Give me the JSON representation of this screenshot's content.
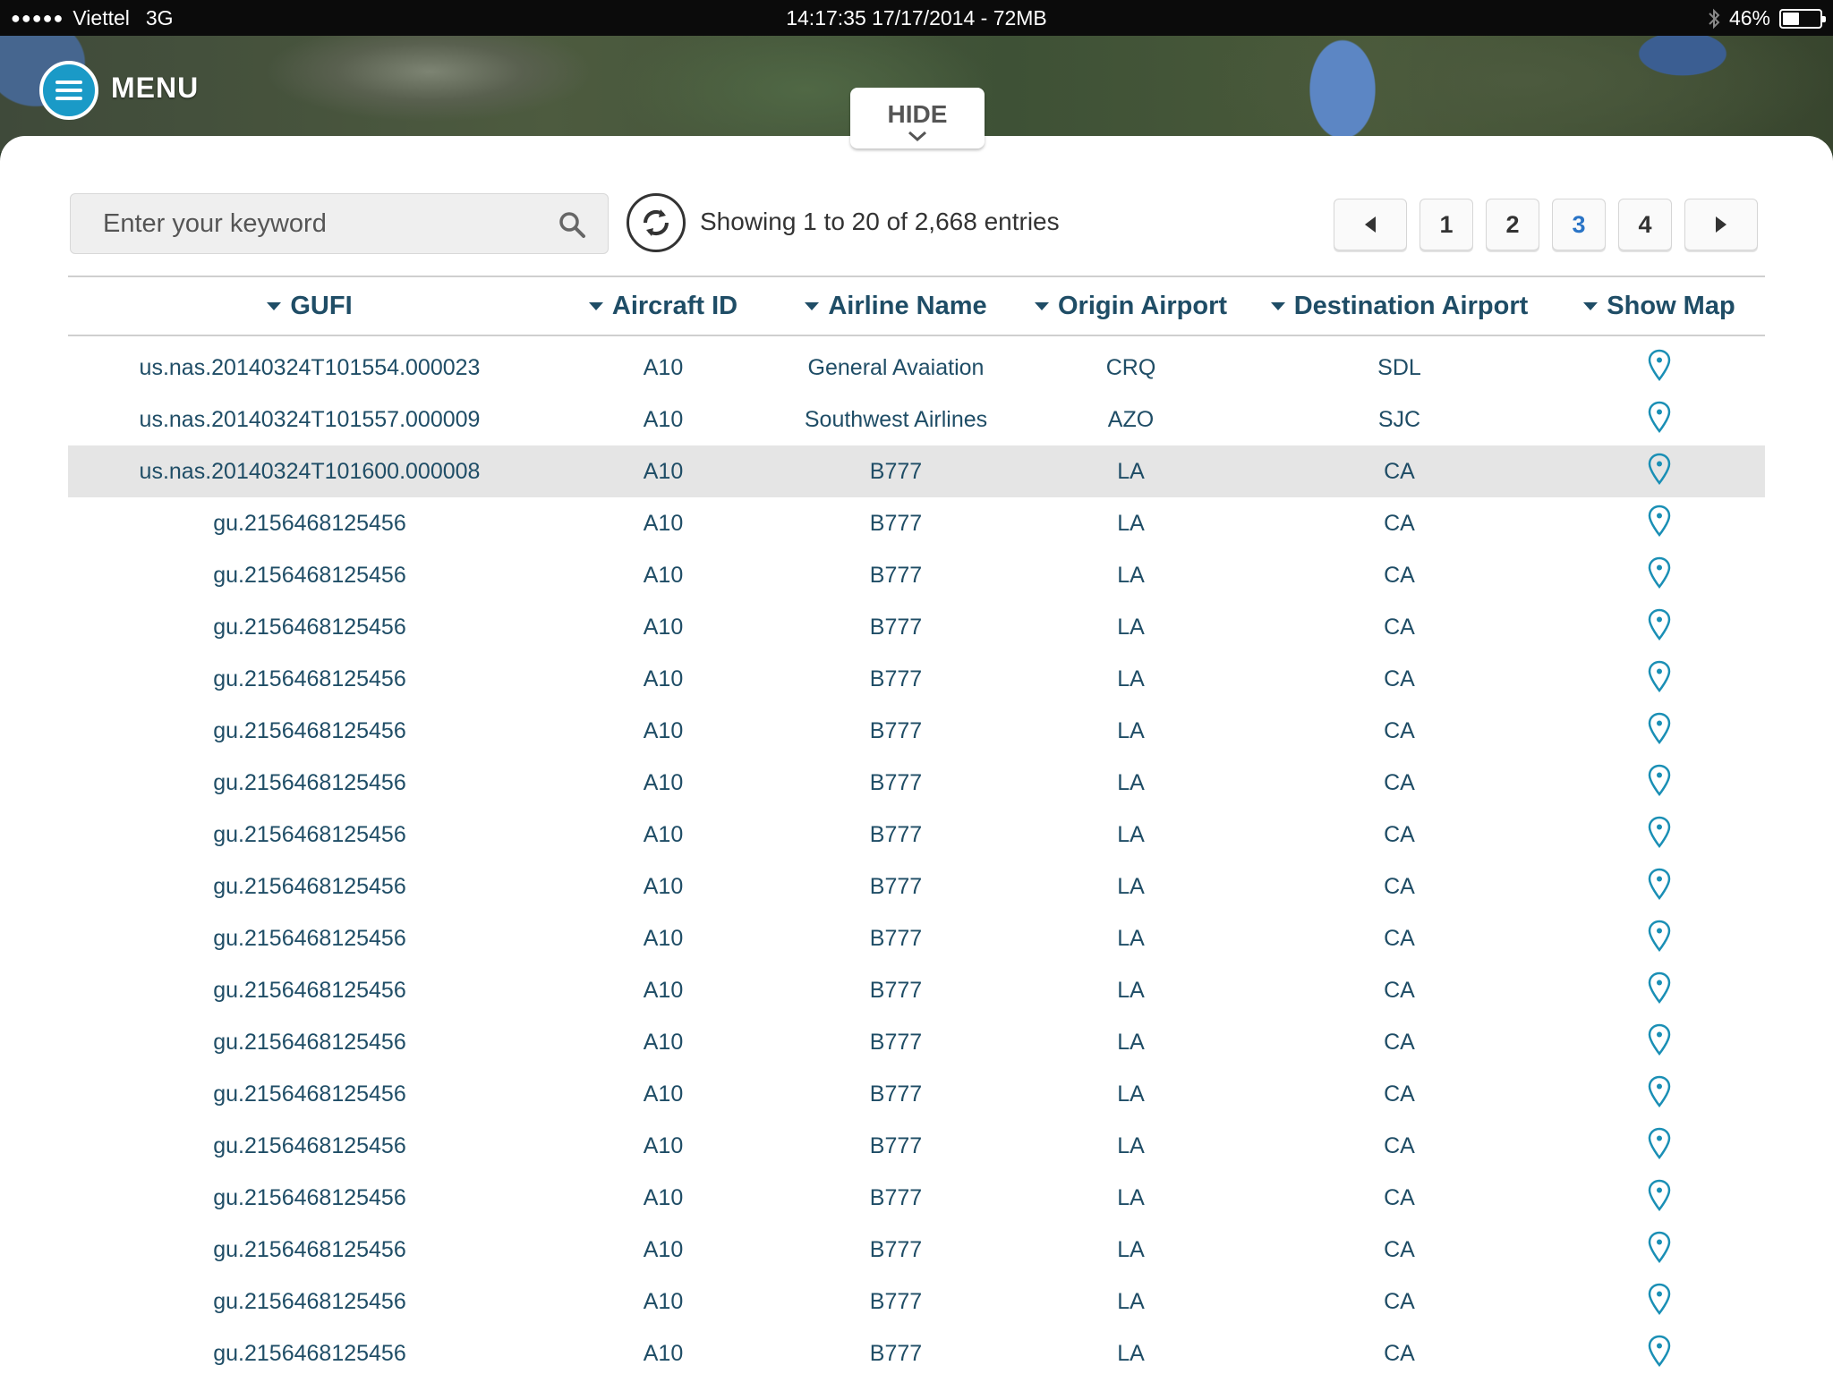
{
  "status_bar": {
    "carrier": "Viettel",
    "network": "3G",
    "center_text": "14:17:35 17/17/2014 - 72MB",
    "battery": "46%",
    "battery_level": 0.46
  },
  "header": {
    "menu_label": "MENU",
    "hide_label": "HIDE"
  },
  "search": {
    "placeholder": "Enter your keyword",
    "value": ""
  },
  "summary": "Showing 1 to 20 of 2,668 entries",
  "pagination": {
    "pages": [
      "1",
      "2",
      "3",
      "4"
    ],
    "active": "3"
  },
  "table": {
    "columns": [
      "GUFI",
      "Aircraft ID",
      "Airline Name",
      "Origin Airport",
      "Destination Airport",
      "Show Map"
    ],
    "selected_row": 2,
    "rows": [
      [
        "us.nas.20140324T101554.000023",
        "A10",
        "General Avaiation",
        "CRQ",
        "SDL"
      ],
      [
        "us.nas.20140324T101557.000009",
        "A10",
        "Southwest Airlines",
        "AZO",
        "SJC"
      ],
      [
        "us.nas.20140324T101600.000008",
        "A10",
        "B777",
        "LA",
        "CA"
      ],
      [
        "gu.2156468125456",
        "A10",
        "B777",
        "LA",
        "CA"
      ],
      [
        "gu.2156468125456",
        "A10",
        "B777",
        "LA",
        "CA"
      ],
      [
        "gu.2156468125456",
        "A10",
        "B777",
        "LA",
        "CA"
      ],
      [
        "gu.2156468125456",
        "A10",
        "B777",
        "LA",
        "CA"
      ],
      [
        "gu.2156468125456",
        "A10",
        "B777",
        "LA",
        "CA"
      ],
      [
        "gu.2156468125456",
        "A10",
        "B777",
        "LA",
        "CA"
      ],
      [
        "gu.2156468125456",
        "A10",
        "B777",
        "LA",
        "CA"
      ],
      [
        "gu.2156468125456",
        "A10",
        "B777",
        "LA",
        "CA"
      ],
      [
        "gu.2156468125456",
        "A10",
        "B777",
        "LA",
        "CA"
      ],
      [
        "gu.2156468125456",
        "A10",
        "B777",
        "LA",
        "CA"
      ],
      [
        "gu.2156468125456",
        "A10",
        "B777",
        "LA",
        "CA"
      ],
      [
        "gu.2156468125456",
        "A10",
        "B777",
        "LA",
        "CA"
      ],
      [
        "gu.2156468125456",
        "A10",
        "B777",
        "LA",
        "CA"
      ],
      [
        "gu.2156468125456",
        "A10",
        "B777",
        "LA",
        "CA"
      ],
      [
        "gu.2156468125456",
        "A10",
        "B777",
        "LA",
        "CA"
      ],
      [
        "gu.2156468125456",
        "A10",
        "B777",
        "LA",
        "CA"
      ],
      [
        "gu.2156468125456",
        "A10",
        "B777",
        "LA",
        "CA"
      ]
    ]
  },
  "icons": {
    "row_action": "map-pin-icon",
    "search": "search-icon",
    "refresh": "refresh-icon",
    "menu": "hamburger-icon"
  },
  "colors": {
    "accent": "#1a9ac7",
    "text_primary": "#1f4d66",
    "active_page": "#2a74c6",
    "selected_row": "#e5e5e5"
  }
}
